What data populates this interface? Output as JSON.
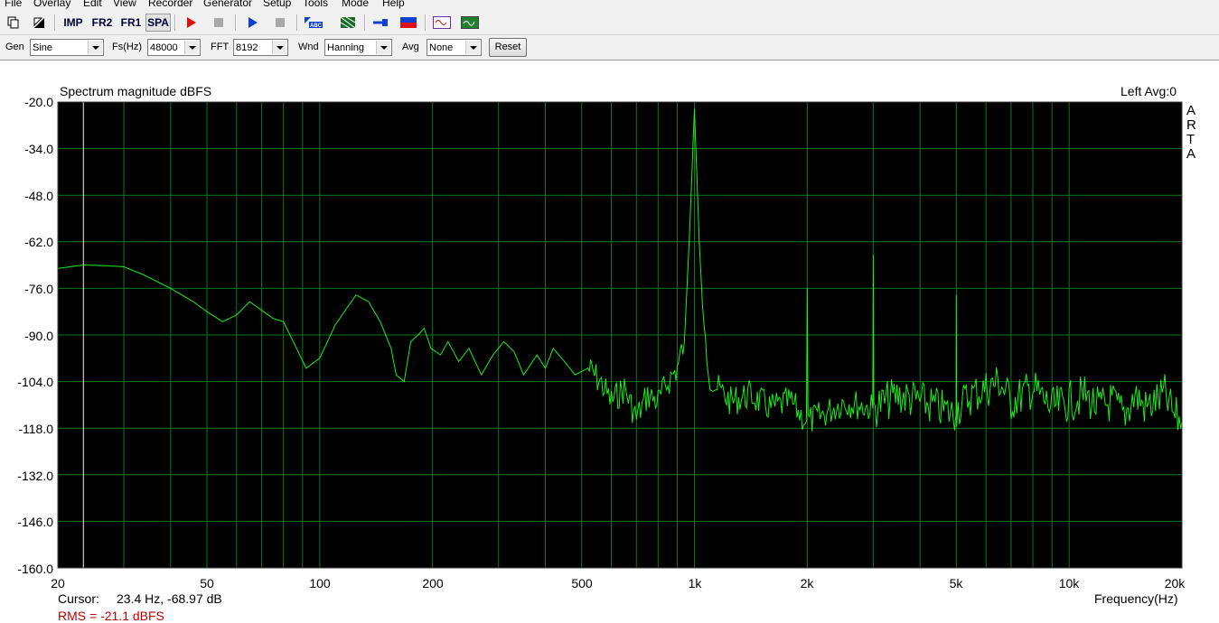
{
  "menu": [
    "File",
    "Overlay",
    "Edit",
    "View",
    "Recorder",
    "Generator",
    "Setup",
    "Tools",
    "Mode",
    "Help"
  ],
  "toolbar": {
    "imp_label": "IMP",
    "fr2_label": "FR2",
    "fr1_label": "FR1",
    "spa_label": "SPA"
  },
  "controls": {
    "gen_label": "Gen",
    "gen_value": "Sine",
    "fs_label": "Fs(Hz)",
    "fs_value": "48000",
    "fft_label": "FFT",
    "fft_value": "8192",
    "wnd_label": "Wnd",
    "wnd_value": "Hanning",
    "avg_label": "Avg",
    "avg_value": "None",
    "reset_label": "Reset"
  },
  "plot": {
    "title": "Spectrum magnitude dBFS",
    "channel_info": "Left  Avg:0",
    "watermark": [
      "A",
      "R",
      "T",
      "A"
    ],
    "cursor_label": "Cursor:",
    "cursor_value": "23.4 Hz, -68.97 dB",
    "rms_text": "RMS = -21.1 dBFS",
    "x_axis_title": "Frequency(Hz)"
  },
  "colors": {
    "background": "#000000",
    "grid": "#0a7a1a",
    "trace": "#18ee18",
    "cursor": "#f4f4c8",
    "rms_text": "#c00000"
  },
  "chart_data": {
    "type": "line",
    "title": "Spectrum magnitude dBFS",
    "xlabel": "Frequency(Hz)",
    "ylabel": "",
    "x_scale": "log",
    "xlim": [
      20,
      20000
    ],
    "ylim": [
      -160,
      -20
    ],
    "x_ticks": [
      "20",
      "50",
      "100",
      "200",
      "500",
      "1k",
      "2k",
      "5k",
      "10k",
      "20k"
    ],
    "y_ticks": [
      "-20.0",
      "-34.0",
      "-48.0",
      "-62.0",
      "-76.0",
      "-90.0",
      "-104.0",
      "-118.0",
      "-132.0",
      "-146.0",
      "-160.0"
    ],
    "grid": true,
    "cursor": {
      "x": 23.4,
      "y": -68.97
    },
    "series": [
      {
        "x": [
          20,
          23.4,
          27,
          30,
          34,
          40,
          46,
          50,
          55,
          60,
          65,
          75,
          80,
          85,
          92,
          100,
          110,
          118,
          125,
          135,
          145,
          155,
          160,
          168,
          175,
          183,
          190,
          198,
          210,
          220,
          235,
          250,
          270,
          290,
          310,
          330,
          350,
          380,
          400,
          420,
          450,
          480,
          520,
          560,
          600,
          650,
          700,
          750,
          800,
          850,
          900,
          940,
          970,
          1000,
          1030,
          1060,
          1100,
          1150,
          1250,
          1400,
          1600,
          1800,
          1990,
          2000,
          2010,
          2200,
          2500,
          2990,
          3000,
          3010,
          3500,
          4000,
          4500,
          4990,
          5000,
          5010,
          5500,
          6000,
          6500,
          7000,
          7500,
          8000,
          9000,
          10000,
          11000,
          12000,
          13000,
          14000,
          15000,
          16000,
          17000,
          18000,
          19000,
          20000
        ],
        "y": [
          -70,
          -68.97,
          -69.2,
          -69.5,
          -72,
          -76,
          -80,
          -83,
          -86,
          -84,
          -80,
          -85,
          -86,
          -92,
          -100,
          -97,
          -87,
          -82,
          -78,
          -80,
          -86,
          -94,
          -102,
          -104,
          -92,
          -90,
          -88,
          -94,
          -96,
          -92,
          -98,
          -94,
          -102,
          -96,
          -92,
          -95,
          -102,
          -96,
          -100,
          -94,
          -98,
          -102,
          -100,
          -104,
          -110,
          -106,
          -115,
          -108,
          -110,
          -104,
          -100,
          -92,
          -60,
          -22,
          -62,
          -90,
          -102,
          -106,
          -110,
          -108,
          -112,
          -110,
          -116,
          -76,
          -116,
          -114,
          -110,
          -112,
          -66,
          -112,
          -108,
          -110,
          -112,
          -114,
          -78,
          -112,
          -108,
          -106,
          -104,
          -110,
          -108,
          -106,
          -112,
          -110,
          -108,
          -112,
          -110,
          -114,
          -108,
          -112,
          -110,
          -108,
          -114,
          -116
        ]
      }
    ]
  }
}
